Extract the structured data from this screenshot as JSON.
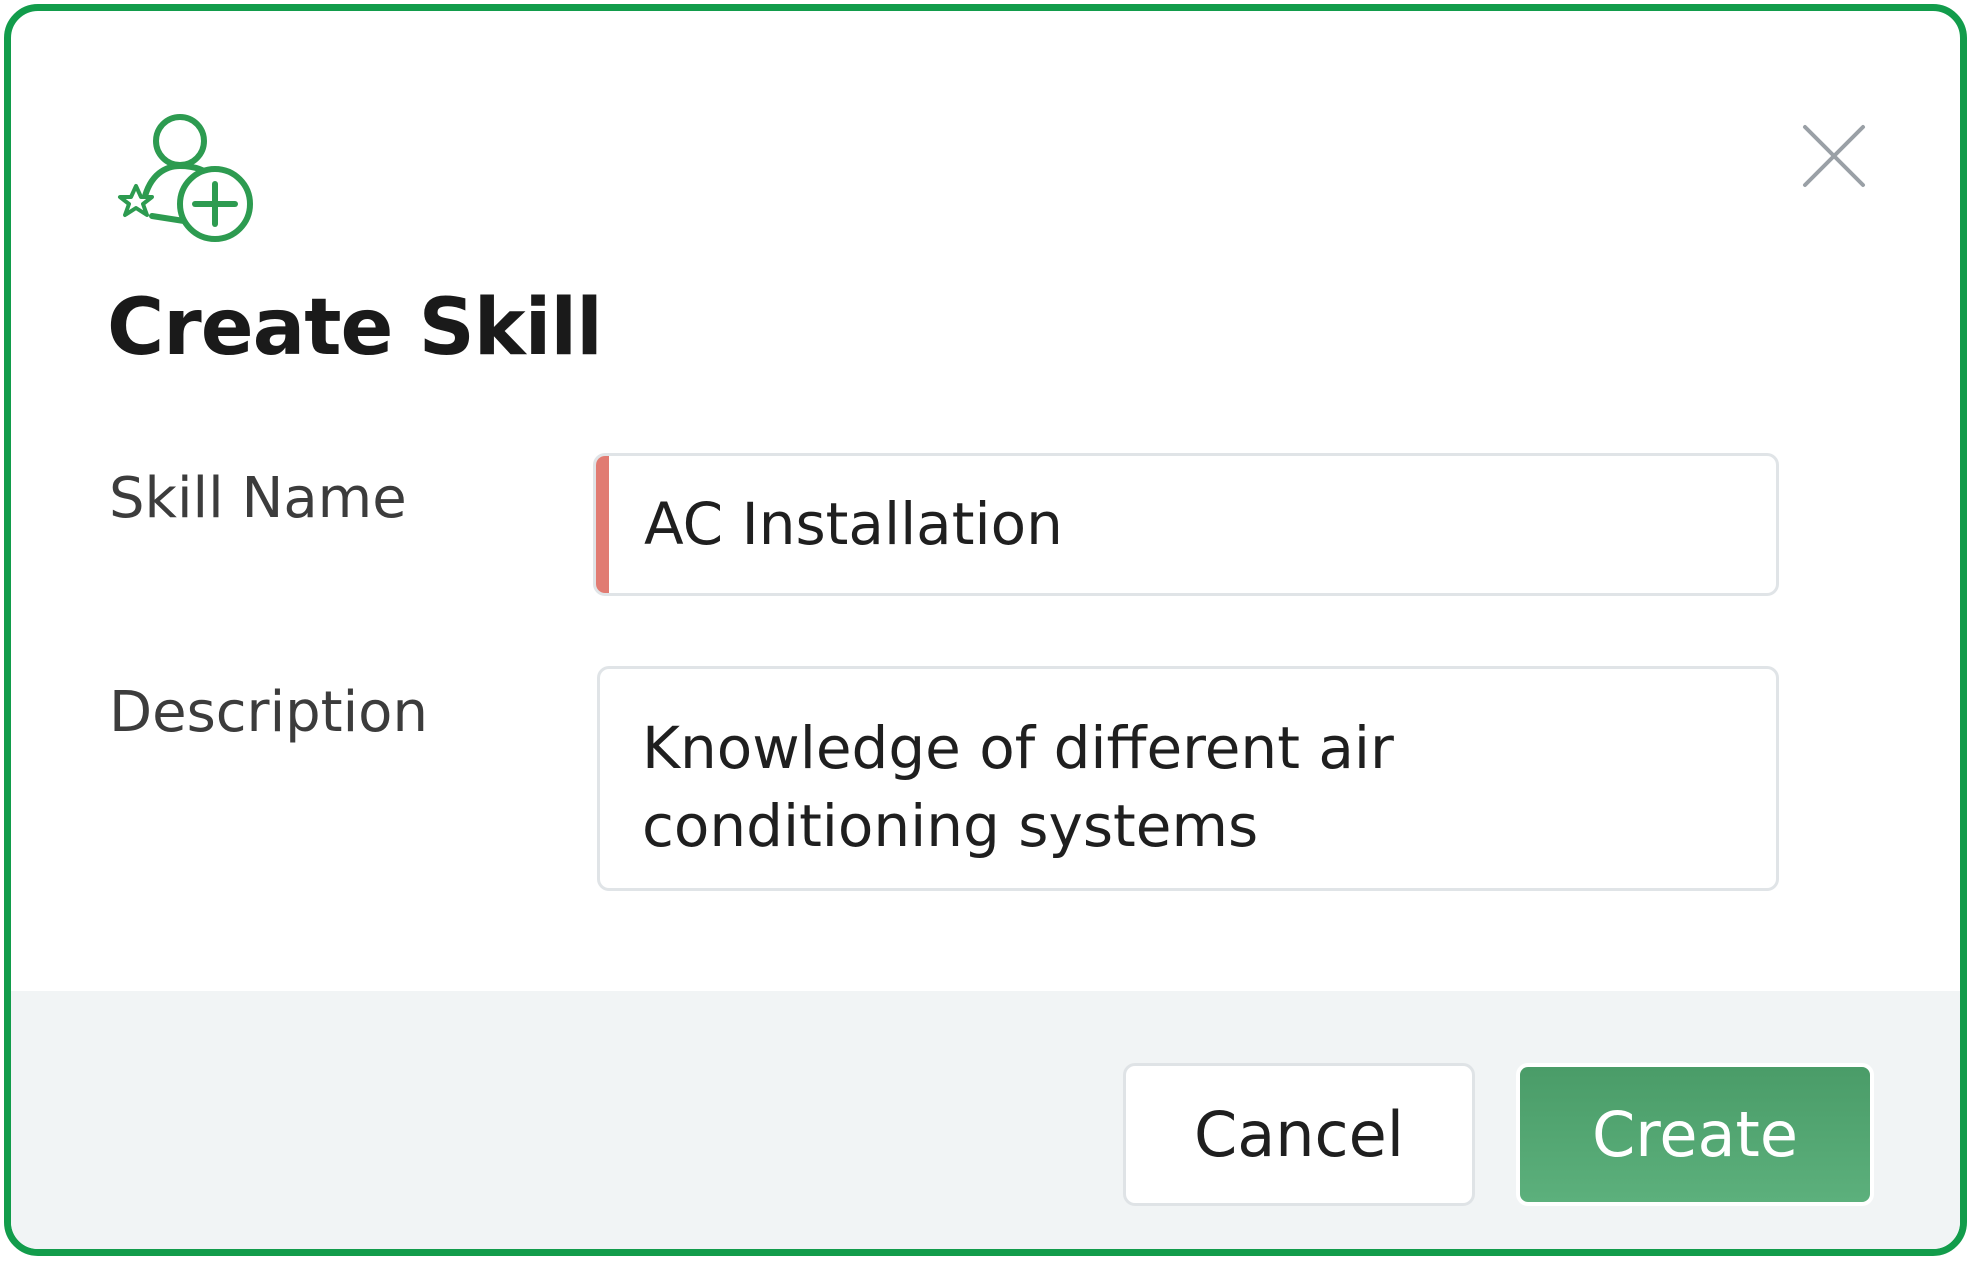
{
  "dialog": {
    "title": "Create Skill",
    "header_icon": "add-skill-user-icon",
    "close_icon": "close-icon"
  },
  "form": {
    "skill_name_label": "Skill Name",
    "skill_name_value": "AC Installation",
    "description_label": "Description",
    "description_value": "Knowledge of different air conditioning systems"
  },
  "footer": {
    "cancel_label": "Cancel",
    "create_label": "Create"
  },
  "colors": {
    "accent": "#129c4b",
    "primary_button": "#54a773",
    "required_indicator": "#e17b72",
    "footer_bg": "#f1f4f5"
  }
}
